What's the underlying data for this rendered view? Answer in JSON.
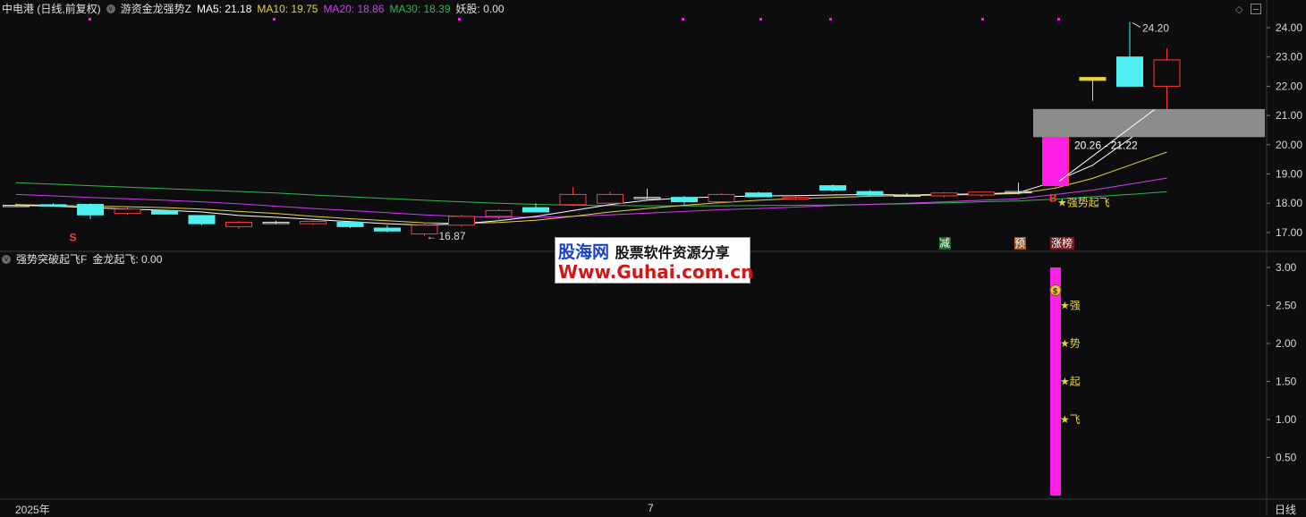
{
  "header": {
    "stock": "中电港 (日线,前复权)",
    "indicator": "游资金龙强势Z",
    "ma5_label": "MA5: 21.18",
    "ma10_label": "MA10: 19.75",
    "ma20_label": "MA20: 18.86",
    "ma30_label": "MA30: 18.39",
    "yao_label": "妖股: 0.00"
  },
  "sub_header": {
    "indicator": "强势突破起飞F",
    "value_label": "金龙起飞: 0.00"
  },
  "colors": {
    "background": "#0d0d0f",
    "up": "#ff3a3a",
    "down": "#4ef0f0",
    "ma5": "#ffffff",
    "ma10": "#e6d23c",
    "ma20": "#d23cf0",
    "ma30": "#2fb84c",
    "magenta": "#ff1ee6",
    "grid": "#2a2a2e",
    "zone": "#8c8c8c"
  },
  "annotations": {
    "high": "24.20",
    "low": "16.87",
    "zone_label": "20.26 - 21.22",
    "buy_mark": "B",
    "sell_mark": "S",
    "signal_text": "★强势起飞",
    "tag_jian": "减",
    "tag_yu": "预",
    "tag_zhangting": "涨榜"
  },
  "sub_chars": [
    "★强",
    "★势",
    "★起",
    "★飞"
  ],
  "footer": {
    "year": "2025年",
    "month": "7",
    "period_tab": "日线"
  },
  "watermark": {
    "site": "股海网",
    "slogan": "股票软件资源分享",
    "url": "Www.Guhai.com.cn"
  },
  "chart_data": [
    {
      "type": "candlestick",
      "ylim": [
        16.6,
        24.4
      ],
      "y_ticks": [
        "24.00",
        "23.00",
        "22.00",
        "21.00",
        "20.00",
        "19.00",
        "18.00",
        "17.00"
      ],
      "candles": [
        {
          "o": 17.93,
          "h": 17.99,
          "l": 17.88,
          "c": 17.93
        },
        {
          "o": 17.95,
          "h": 18.0,
          "l": 17.92,
          "c": 17.92
        },
        {
          "o": 17.96,
          "h": 18.0,
          "l": 17.45,
          "c": 17.6
        },
        {
          "o": 17.65,
          "h": 17.87,
          "l": 17.6,
          "c": 17.8
        },
        {
          "o": 17.75,
          "h": 17.78,
          "l": 17.6,
          "c": 17.63
        },
        {
          "o": 17.58,
          "h": 17.6,
          "l": 17.25,
          "c": 17.3
        },
        {
          "o": 17.2,
          "h": 17.38,
          "l": 17.12,
          "c": 17.35
        },
        {
          "o": 17.35,
          "h": 17.4,
          "l": 17.28,
          "c": 17.35
        },
        {
          "o": 17.3,
          "h": 17.42,
          "l": 17.25,
          "c": 17.38
        },
        {
          "o": 17.35,
          "h": 17.4,
          "l": 17.15,
          "c": 17.2
        },
        {
          "o": 17.15,
          "h": 17.25,
          "l": 17.0,
          "c": 17.05
        },
        {
          "o": 16.95,
          "h": 17.35,
          "l": 16.87,
          "c": 17.25
        },
        {
          "o": 17.25,
          "h": 17.6,
          "l": 17.2,
          "c": 17.55
        },
        {
          "o": 17.55,
          "h": 17.8,
          "l": 17.45,
          "c": 17.75
        },
        {
          "o": 17.85,
          "h": 18.0,
          "l": 17.7,
          "c": 17.7
        },
        {
          "o": 17.95,
          "h": 18.55,
          "l": 17.9,
          "c": 18.3
        },
        {
          "o": 18.0,
          "h": 18.4,
          "l": 17.95,
          "c": 18.3
        },
        {
          "o": 18.2,
          "h": 18.5,
          "l": 18.15,
          "c": 18.2
        },
        {
          "o": 18.2,
          "h": 18.25,
          "l": 17.95,
          "c": 18.05
        },
        {
          "o": 18.05,
          "h": 18.35,
          "l": 18.0,
          "c": 18.3
        },
        {
          "o": 18.35,
          "h": 18.4,
          "l": 18.2,
          "c": 18.22
        },
        {
          "o": 18.15,
          "h": 18.25,
          "l": 18.1,
          "c": 18.2
        },
        {
          "o": 18.6,
          "h": 18.65,
          "l": 18.4,
          "c": 18.45
        },
        {
          "o": 18.4,
          "h": 18.45,
          "l": 18.25,
          "c": 18.28
        },
        {
          "o": 18.28,
          "h": 18.35,
          "l": 18.22,
          "c": 18.28
        },
        {
          "o": 18.25,
          "h": 18.38,
          "l": 18.2,
          "c": 18.35
        },
        {
          "o": 18.28,
          "h": 18.4,
          "l": 18.22,
          "c": 18.38
        },
        {
          "o": 18.38,
          "h": 18.7,
          "l": 18.3,
          "c": 18.4
        },
        {
          "o": 18.6,
          "h": 20.26,
          "l": 18.55,
          "c": 20.26
        },
        {
          "o": 22.3,
          "h": 22.3,
          "l": 21.5,
          "c": 22.2
        },
        {
          "o": 23.0,
          "h": 24.2,
          "l": 22.0,
          "c": 22.0
        },
        {
          "o": 22.0,
          "h": 23.3,
          "l": 21.2,
          "c": 22.9
        }
      ],
      "ma5": [
        17.93,
        17.9,
        17.85,
        17.8,
        17.76,
        17.7,
        17.58,
        17.52,
        17.45,
        17.37,
        17.3,
        17.25,
        17.3,
        17.4,
        17.55,
        17.75,
        17.95,
        18.1,
        18.18,
        18.22,
        18.25,
        18.26,
        18.28,
        18.3,
        18.28,
        18.3,
        18.32,
        18.36,
        18.75,
        19.3,
        20.2,
        21.18
      ],
      "ma10": [
        17.95,
        17.93,
        17.9,
        17.88,
        17.85,
        17.8,
        17.72,
        17.65,
        17.55,
        17.47,
        17.4,
        17.33,
        17.31,
        17.34,
        17.42,
        17.55,
        17.7,
        17.82,
        17.93,
        18.02,
        18.1,
        18.16,
        18.2,
        18.24,
        18.26,
        18.28,
        18.3,
        18.33,
        18.52,
        18.85,
        19.3,
        19.75
      ],
      "ma20": [
        18.3,
        18.25,
        18.2,
        18.15,
        18.1,
        18.05,
        17.98,
        17.9,
        17.82,
        17.75,
        17.68,
        17.6,
        17.55,
        17.52,
        17.52,
        17.55,
        17.6,
        17.66,
        17.72,
        17.78,
        17.82,
        17.87,
        17.92,
        17.96,
        18.0,
        18.05,
        18.1,
        18.15,
        18.3,
        18.45,
        18.65,
        18.86
      ],
      "ma30": [
        18.7,
        18.65,
        18.6,
        18.55,
        18.5,
        18.45,
        18.4,
        18.35,
        18.28,
        18.22,
        18.16,
        18.1,
        18.05,
        18.0,
        17.96,
        17.93,
        17.92,
        17.91,
        17.91,
        17.91,
        17.92,
        17.93,
        17.94,
        17.96,
        17.98,
        18.01,
        18.05,
        18.08,
        18.14,
        18.22,
        18.3,
        18.39
      ],
      "zone": [
        20.26,
        21.22
      ]
    },
    {
      "type": "bar",
      "ylim": [
        0,
        3.05
      ],
      "y_ticks": [
        "3.00",
        "2.50",
        "2.00",
        "1.50",
        "1.00",
        "0.50"
      ],
      "bar_index": 28,
      "bar_value": 3.0,
      "char_levels": [
        2.5,
        2.0,
        1.5,
        1.0
      ]
    }
  ]
}
